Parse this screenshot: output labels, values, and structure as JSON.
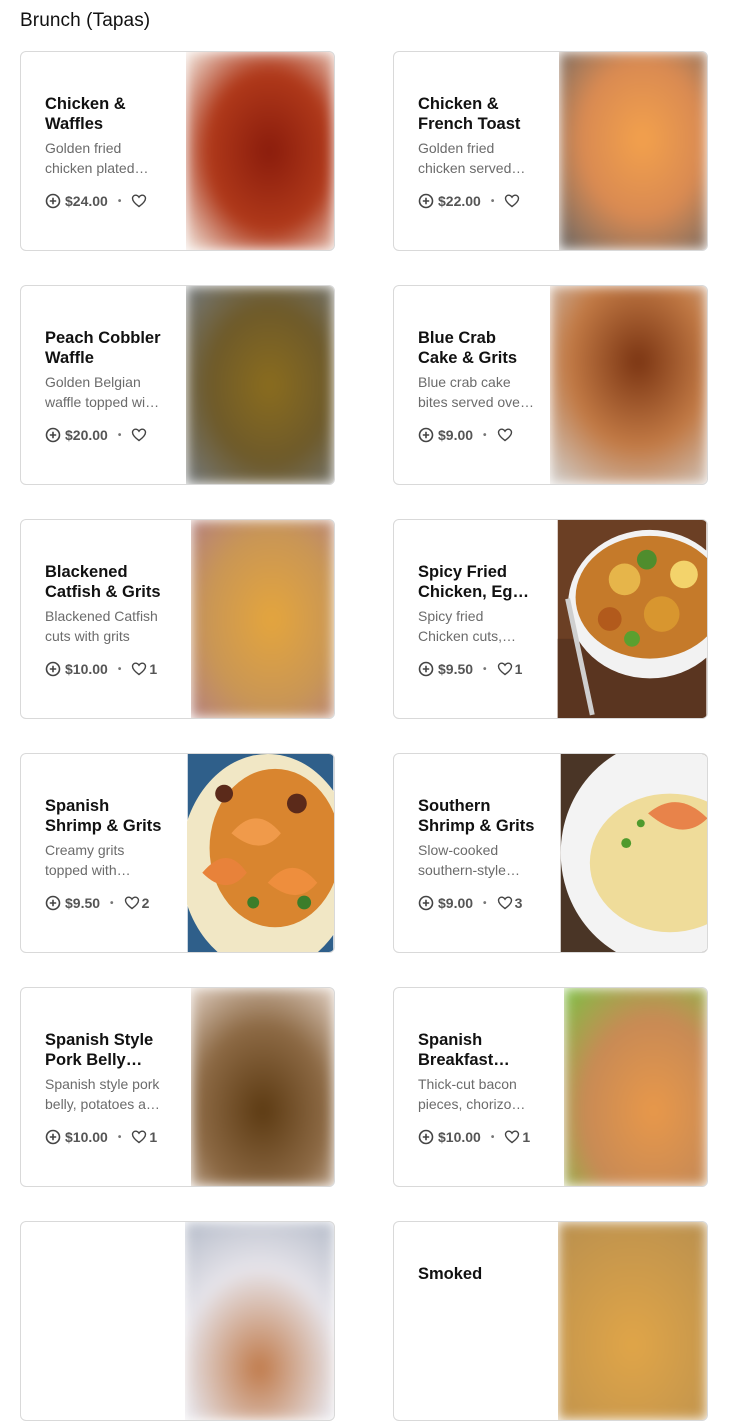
{
  "section": {
    "title": "Brunch (Tapas)"
  },
  "items": [
    {
      "name": "Chicken & Waffles",
      "desc": "Golden fried chicken plated with waffles",
      "price": "$24.00",
      "likes": ""
    },
    {
      "name": "Chicken & French Toast",
      "desc": "Golden fried chicken served with french toast",
      "price": "$22.00",
      "likes": ""
    },
    {
      "name": "Peach Cobbler Waffle",
      "desc": "Golden Belgian waffle topped with peach cobbler",
      "price": "$20.00",
      "likes": ""
    },
    {
      "name": "Blue Crab Cake & Grits",
      "desc": "Blue crab cake bites served over grits",
      "price": "$9.00",
      "likes": ""
    },
    {
      "name": "Blackened Catfish & Grits",
      "desc": "Blackened Catfish cuts with grits",
      "price": "$10.00",
      "likes": "1"
    },
    {
      "name": "Spicy Fried Chicken, Egg & Potatoes",
      "desc": "Spicy fried Chicken cuts, eggs and potatoes",
      "price": "$9.50",
      "likes": "1"
    },
    {
      "name": "Spanish Shrimp & Grits",
      "desc": "Creamy grits topped with spanish shrimp",
      "price": "$9.50",
      "likes": "2"
    },
    {
      "name": "Southern Shrimp & Grits",
      "desc": "Slow-cooked southern-style grits with shrimp",
      "price": "$9.00",
      "likes": "3"
    },
    {
      "name": "Spanish Style Pork Belly Hash",
      "desc": "Spanish style pork belly, potatoes and peppers",
      "price": "$10.00",
      "likes": "1"
    },
    {
      "name": "Spanish Breakfast Potatoes",
      "desc": "Thick-cut bacon pieces, chorizo and potatoes",
      "price": "$10.00",
      "likes": "1"
    },
    {
      "name": "",
      "desc": "",
      "price": "",
      "likes": ""
    },
    {
      "name": "Smoked",
      "desc": "",
      "price": "",
      "likes": ""
    }
  ],
  "colors": {
    "border": "#d9d9d9",
    "text_secondary": "#6b6b6b"
  },
  "icons": {
    "add": "plus-circle-icon",
    "favorite": "heart-outline-icon"
  }
}
